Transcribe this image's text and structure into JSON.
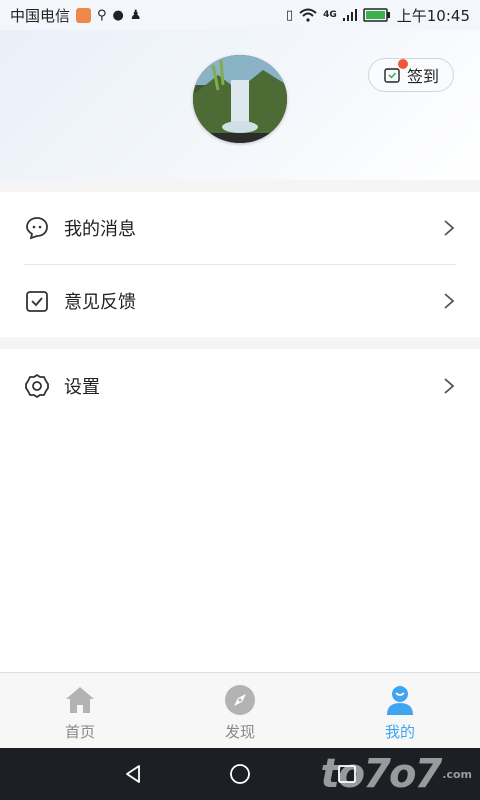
{
  "status_bar": {
    "carrier": "中国电信",
    "time": "上午10:45",
    "signal_text": "4G"
  },
  "header": {
    "checkin_label": "签到"
  },
  "menu": {
    "items": [
      {
        "label": "我的消息",
        "icon": "chat-bubble-icon"
      },
      {
        "label": "意见反馈",
        "icon": "feedback-check-icon"
      },
      {
        "label": "设置",
        "icon": "gear-icon"
      }
    ]
  },
  "bottom_nav": {
    "tabs": [
      {
        "label": "首页",
        "icon": "home-icon",
        "active": false
      },
      {
        "label": "发现",
        "icon": "compass-icon",
        "active": false
      },
      {
        "label": "我的",
        "icon": "user-icon",
        "active": true
      }
    ]
  },
  "watermark": {
    "text": "to7o7",
    "suffix": ".com"
  },
  "colors": {
    "accent": "#3ea6f0",
    "badge_dot": "#f2553c",
    "inactive": "#aaaaaa"
  }
}
